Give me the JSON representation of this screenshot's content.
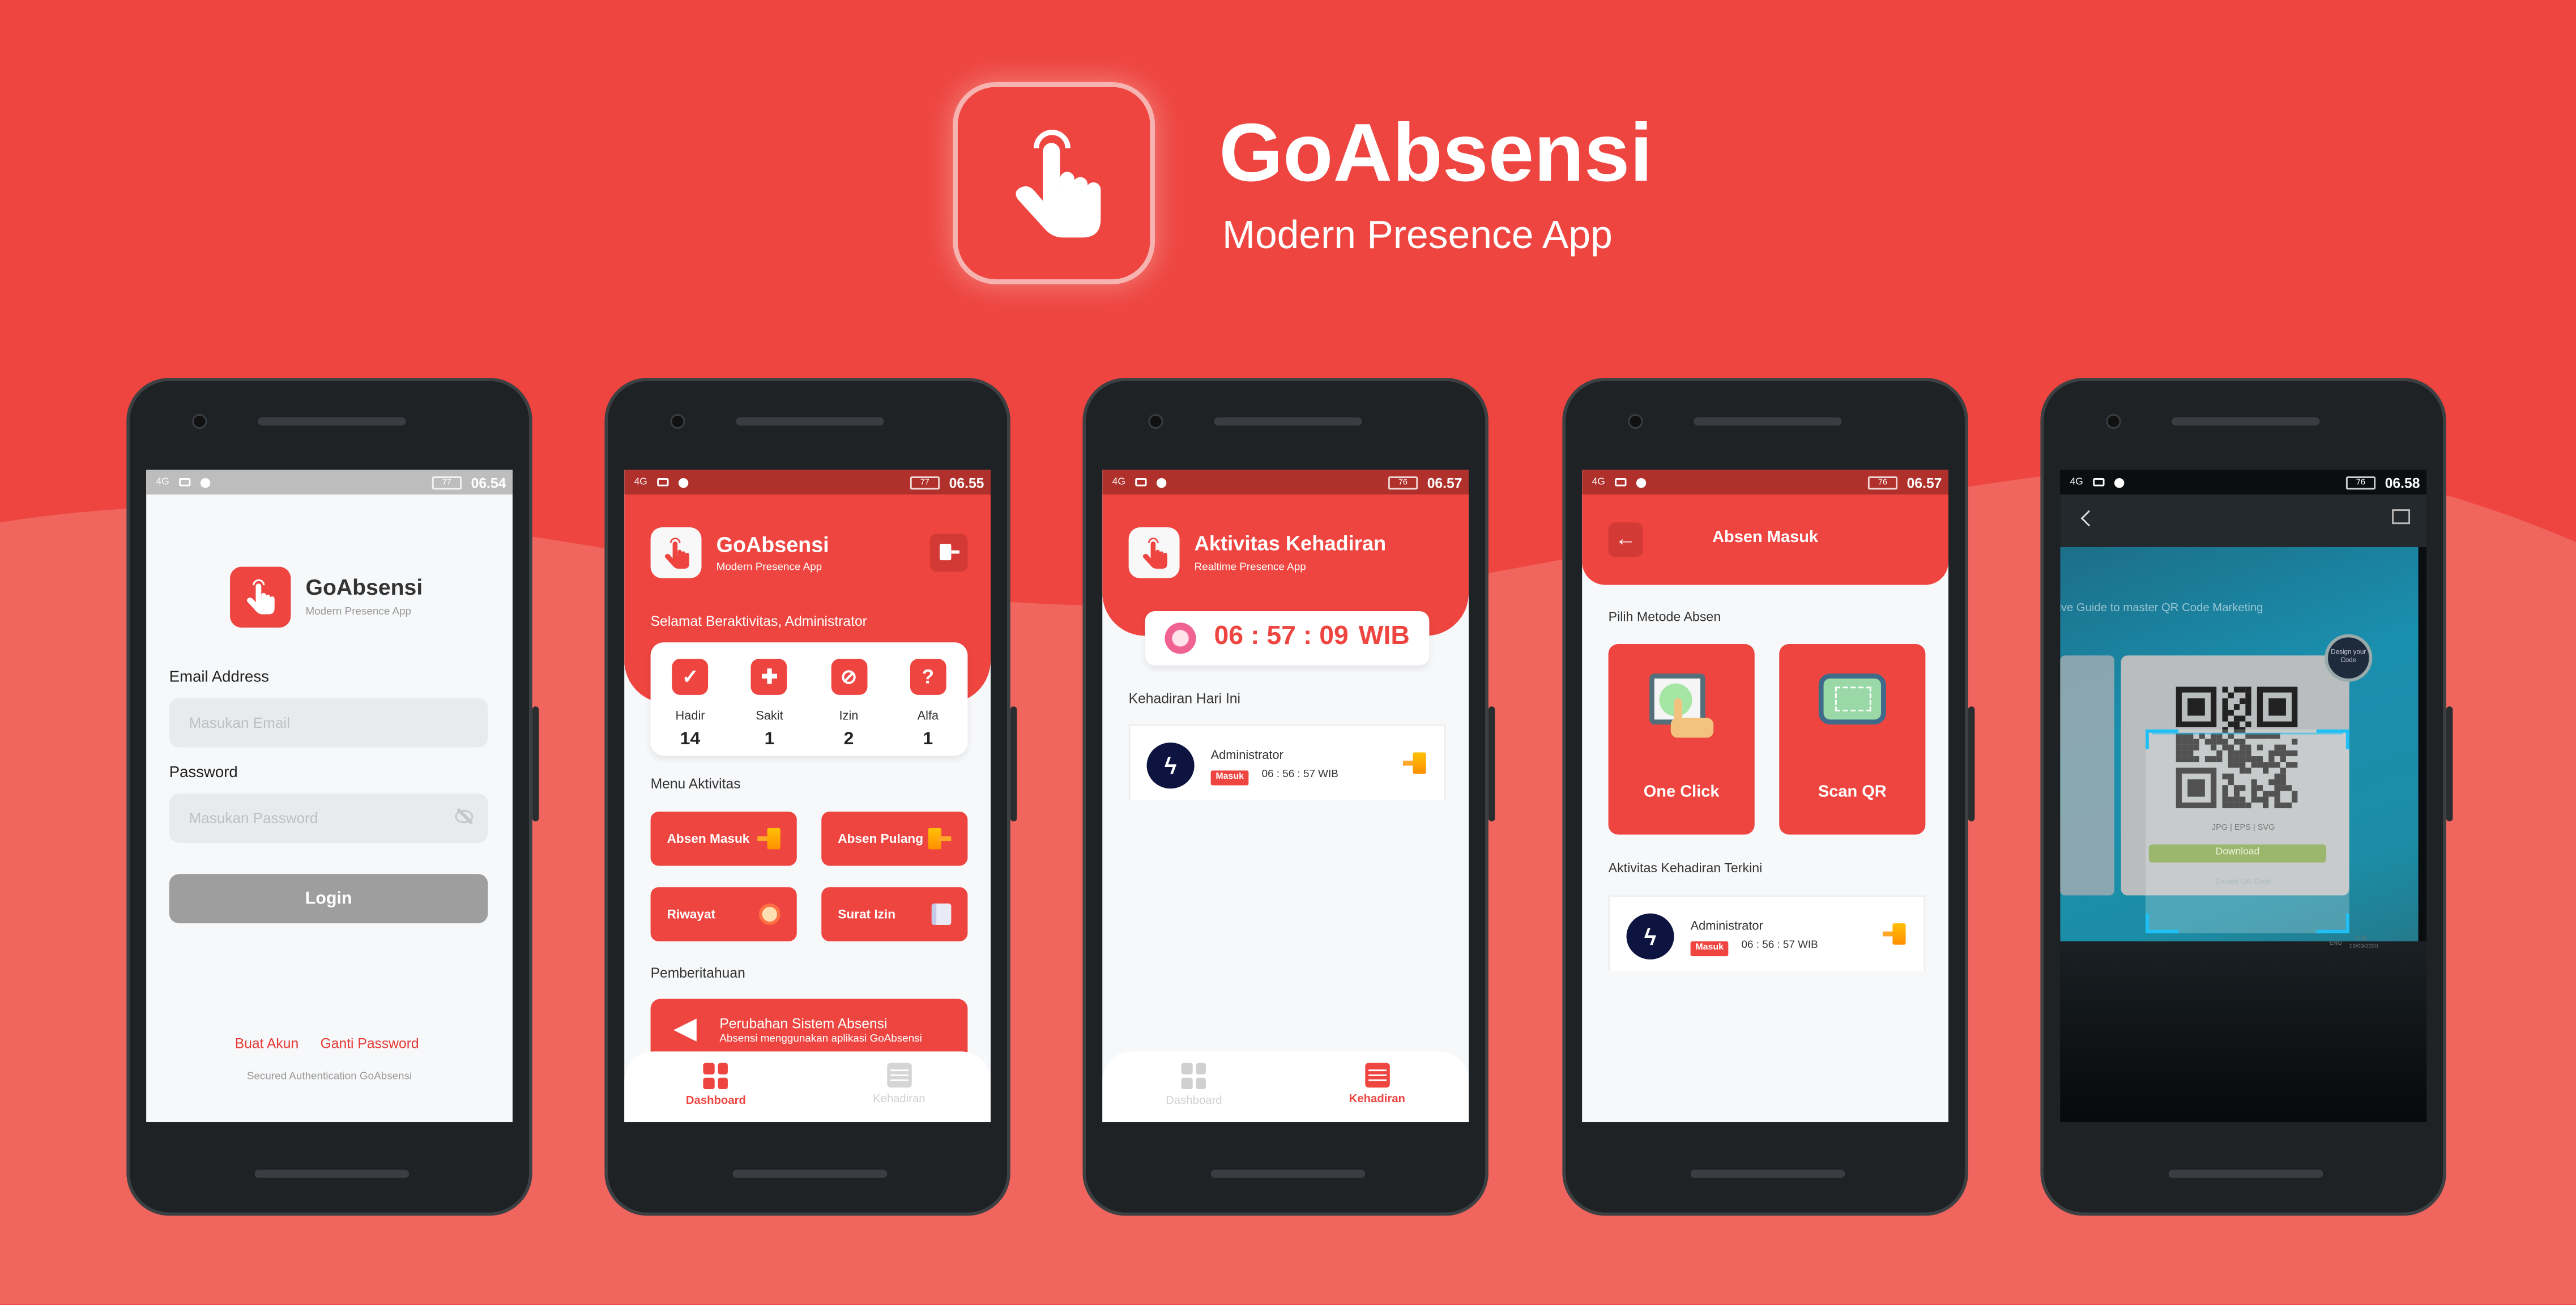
{
  "brand": {
    "title": "GoAbsensi",
    "subtitle": "Modern Presence App",
    "icon": "pointing-hand-icon",
    "colors": {
      "primary": "#EE4540",
      "background_light": "#F0665F",
      "phone_body": "#1F2225"
    }
  },
  "login": {
    "status": {
      "network": "4G",
      "battery": "77",
      "time": "06.54"
    },
    "app_title": "GoAbsensi",
    "app_subtitle": "Modern Presence App",
    "email_label": "Email Address",
    "email_placeholder": "Masukan Email",
    "email_value": "",
    "password_label": "Password",
    "password_placeholder": "Masukan Password",
    "password_value": "",
    "login_button": "Login",
    "create_account_link": "Buat Akun",
    "change_password_link": "Ganti Password",
    "footer": "Secured Authentication GoAbsensi"
  },
  "dashboard": {
    "status": {
      "network": "4G",
      "battery": "77",
      "time": "06.55"
    },
    "app_title": "GoAbsensi",
    "app_subtitle": "Modern Presence App",
    "greeting": "Selamat Beraktivitas, Administrator",
    "stats": [
      {
        "label": "Hadir",
        "value": "14",
        "icon": "check-icon"
      },
      {
        "label": "Sakit",
        "value": "1",
        "icon": "sick-icon"
      },
      {
        "label": "Izin",
        "value": "2",
        "icon": "permission-icon"
      },
      {
        "label": "Alfa",
        "value": "1",
        "icon": "absent-icon"
      }
    ],
    "menu_title": "Menu Aktivitas",
    "menu": [
      {
        "label": "Absen Masuk",
        "icon": "door-enter-icon"
      },
      {
        "label": "Absen Pulang",
        "icon": "door-exit-icon"
      },
      {
        "label": "Riwayat",
        "icon": "history-icon"
      },
      {
        "label": "Surat Izin",
        "icon": "letter-icon"
      }
    ],
    "notice_title": "Pemberitahuan",
    "notice": {
      "title": "Perubahan Sistem Absensi",
      "body": "Absensi menggunakan aplikasi GoAbsensi"
    },
    "nav": [
      {
        "label": "Dashboard",
        "active": true
      },
      {
        "label": "Kehadiran",
        "active": false
      }
    ]
  },
  "kehadiran": {
    "status": {
      "network": "4G",
      "battery": "76",
      "time": "06.57"
    },
    "title": "Aktivitas Kehadiran",
    "subtitle": "Realtime Presence App",
    "clock": {
      "time": "06 : 57 : 09",
      "zone": "WIB"
    },
    "section_title": "Kehadiran Hari Ini",
    "entries": [
      {
        "name": "Administrator",
        "badge": "Masuk",
        "time": "06 : 56 : 57 WIB"
      }
    ],
    "nav": [
      {
        "label": "Dashboard",
        "active": false
      },
      {
        "label": "Kehadiran",
        "active": true
      }
    ]
  },
  "absen_masuk": {
    "status": {
      "network": "4G",
      "battery": "76",
      "time": "06.57"
    },
    "title": "Absen Masuk",
    "method_title": "Pilih Metode Absen",
    "methods": [
      {
        "label": "One Click",
        "icon": "tap-phone-icon"
      },
      {
        "label": "Scan QR",
        "icon": "qr-phone-icon"
      }
    ],
    "recent_title": "Aktivitas Kehadiran Terkini",
    "entries": [
      {
        "name": "Administrator",
        "badge": "Masuk",
        "time": "06 : 56 : 57 WIB"
      }
    ]
  },
  "scan_qr": {
    "status": {
      "network": "4G",
      "battery": "76",
      "time": "06.58"
    },
    "camera_text": {
      "headline": "ive Guide to master QR Code Marketing",
      "design_badge": "Design your Code",
      "formats": "JPG | EPS | SVG",
      "download": "Download",
      "embed": "Embed QR Code",
      "taskbar_lang": "ENG",
      "taskbar_time": "6:58",
      "taskbar_date": "19/09/2020"
    },
    "scan_frame_color": "#1EC0F5"
  }
}
